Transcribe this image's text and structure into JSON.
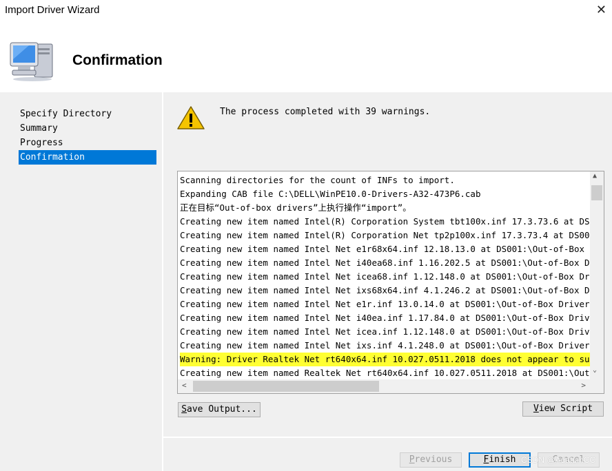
{
  "window": {
    "title": "Import Driver Wizard",
    "close_glyph": "✕"
  },
  "header": {
    "title": "Confirmation",
    "icon": "computer-icon"
  },
  "nav": {
    "items": [
      {
        "label": "Specify Directory"
      },
      {
        "label": "Summary"
      },
      {
        "label": "Progress"
      },
      {
        "label": "Confirmation",
        "selected": true
      }
    ]
  },
  "status": {
    "icon": "warning-icon",
    "message": "The process completed with 39 warnings."
  },
  "output": {
    "lines": [
      {
        "text": "Scanning directories for the count of INFs to import."
      },
      {
        "text": "Expanding CAB file C:\\DELL\\WinPE10.0-Drivers-A32-473P6.cab"
      },
      {
        "text": "正在目标“Out-of-box drivers”上执行操作“import”。"
      },
      {
        "text": "Creating new item named Intel(R) Corporation System tbt100x.inf 17.3.73.6 at DS"
      },
      {
        "text": "Creating new item named Intel(R) Corporation Net tp2p100x.inf 17.3.73.4 at DS00"
      },
      {
        "text": "Creating new item named Intel Net e1r68x64.inf 12.18.13.0 at DS001:\\Out-of-Box"
      },
      {
        "text": "Creating new item named Intel Net i40ea68.inf 1.16.202.5 at DS001:\\Out-of-Box D"
      },
      {
        "text": "Creating new item named Intel Net icea68.inf 1.12.148.0 at DS001:\\Out-of-Box Dr"
      },
      {
        "text": "Creating new item named Intel Net ixs68x64.inf 4.1.246.2 at DS001:\\Out-of-Box D"
      },
      {
        "text": "Creating new item named Intel Net e1r.inf 13.0.14.0 at DS001:\\Out-of-Box Driver"
      },
      {
        "text": "Creating new item named Intel Net i40ea.inf 1.17.84.0 at DS001:\\Out-of-Box Driv"
      },
      {
        "text": "Creating new item named Intel Net icea.inf 1.12.148.0 at DS001:\\Out-of-Box Driv"
      },
      {
        "text": "Creating new item named Intel Net ixs.inf 4.1.248.0 at DS001:\\Out-of-Box Driver"
      },
      {
        "text": "Warning: Driver Realtek Net rt640x64.inf 10.027.0511.2018 does not appear to su",
        "warning": true
      },
      {
        "text": "Creating new item named Realtek Net rt640x64.inf 10.027.0511.2018 at DS001:\\Out"
      }
    ]
  },
  "buttons": {
    "save_output": {
      "mnemonic": "S",
      "rest": "ave Output..."
    },
    "view_script": {
      "mnemonic": "V",
      "rest": "iew Script"
    },
    "previous": {
      "mnemonic": "P",
      "rest": "revious"
    },
    "finish": {
      "mnemonic": "F",
      "rest": "inish"
    },
    "cancel": {
      "label": "Cancel"
    }
  },
  "watermark": "CSDN @AdatumCC",
  "colors": {
    "selection": "#0078d7",
    "warning_highlight": "#ffff33"
  }
}
